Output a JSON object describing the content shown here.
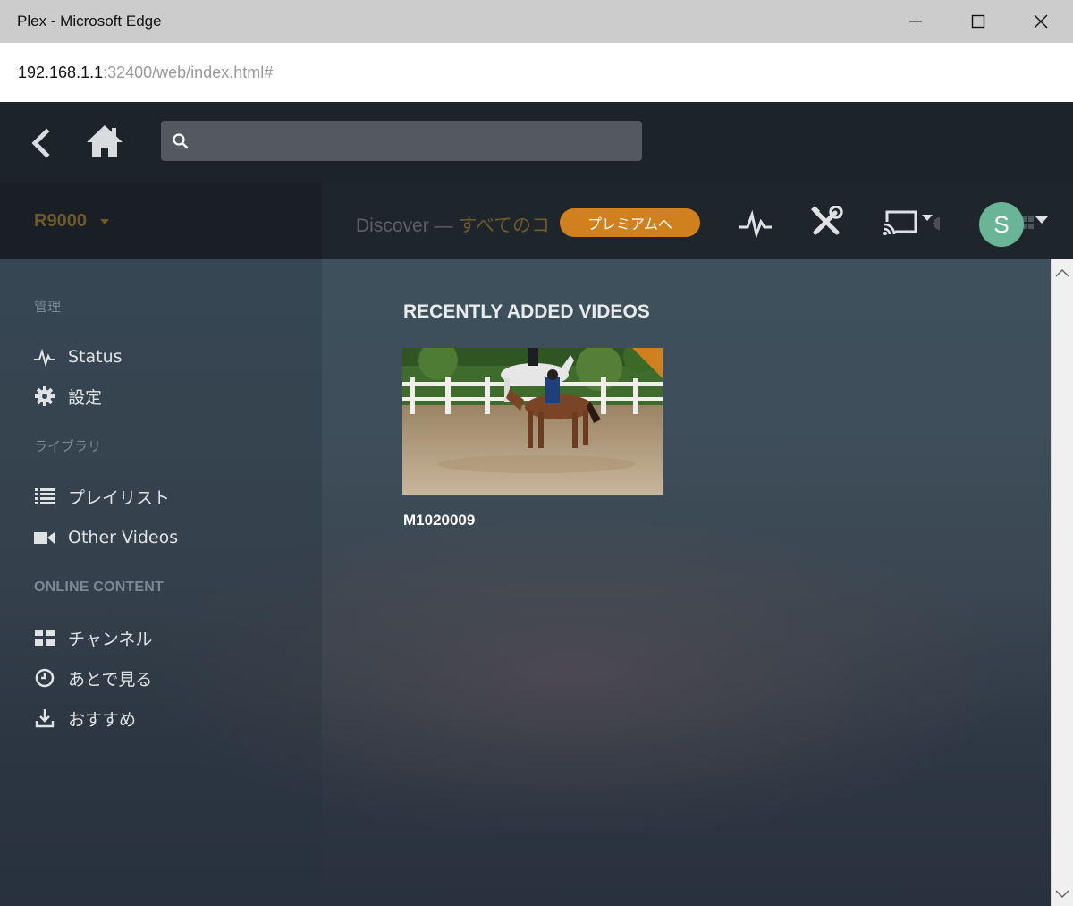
{
  "window": {
    "title": "Plex - Microsoft Edge"
  },
  "address": {
    "host": "192.168.1.1",
    "rest": ":32400/web/index.html#"
  },
  "search": {
    "placeholder": ""
  },
  "server": {
    "name": "R9000"
  },
  "breadcrumb": {
    "discover": "Discover",
    "sep": " — ",
    "section": "すべてのコ"
  },
  "premium": {
    "label": "プレミアムへ"
  },
  "user": {
    "initial": "S"
  },
  "sidebar": {
    "manage_heading": "管理",
    "status_label": "Status",
    "settings_label": "設定",
    "library_heading": "ライブラリ",
    "playlist_label": "プレイリスト",
    "other_videos_label": "Other Videos",
    "online_heading": "ONLINE CONTENT",
    "channels_label": "チャンネル",
    "watch_later_label": "あとで見る",
    "recommended_label": "おすすめ"
  },
  "main": {
    "section_title": "RECENTLY ADDED VIDEOS",
    "items": [
      {
        "title": "M1020009"
      }
    ]
  },
  "colors": {
    "accent": "#d0801c",
    "avatar": "#6ab497",
    "server": "#6b5a2a"
  }
}
